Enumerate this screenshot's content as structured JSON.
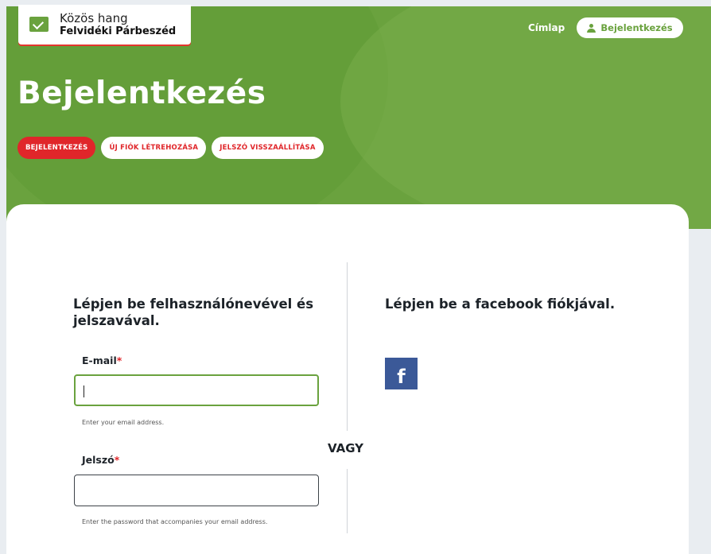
{
  "header": {
    "logo_line1": "Közös hang",
    "logo_line2": "Felvidéki Párbeszéd",
    "nav_home": "Címlap",
    "nav_login": "Bejelentkezés"
  },
  "page": {
    "title": "Bejelentkezés",
    "tabs": [
      {
        "label": "BEJELENTKEZÉS",
        "active": true
      },
      {
        "label": "ÚJ FIÓK LÉTREHOZÁSA",
        "active": false
      },
      {
        "label": "JELSZÓ VISSZAÁLLÍTÁSA",
        "active": false
      }
    ]
  },
  "login_form": {
    "heading": "Lépjen be felhasználónevével és jelszavával.",
    "email": {
      "label": "E-mail",
      "required_mark": "*",
      "value": "",
      "hint": "Enter your email address."
    },
    "password": {
      "label": "Jelszó",
      "required_mark": "*",
      "value": "",
      "hint": "Enter the password that accompanies your email address."
    }
  },
  "separator": "VAGY",
  "facebook": {
    "heading": "Lépjen be a facebook fiókjával.",
    "button_glyph": "f",
    "icon": "facebook-icon"
  },
  "colors": {
    "brand_green": "#6aa23e",
    "accent_red": "#e0262a",
    "facebook_blue": "#3b5998"
  }
}
